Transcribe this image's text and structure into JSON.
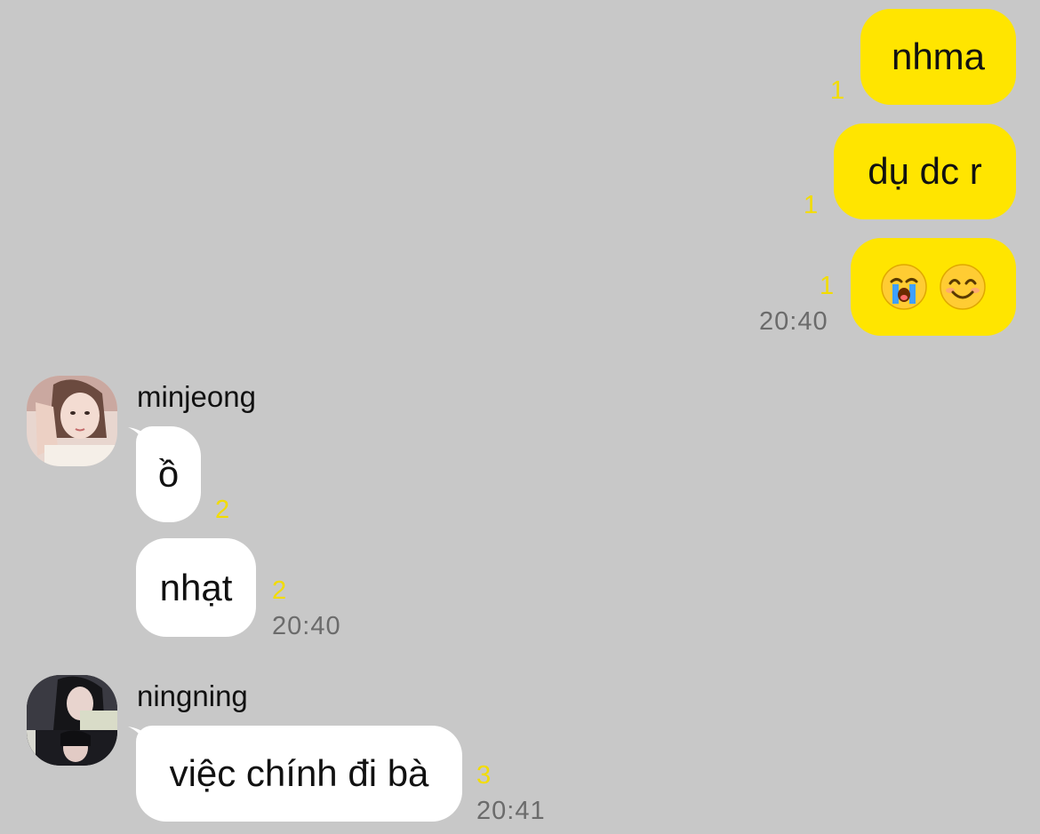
{
  "outgoing": [
    {
      "text": "nhma",
      "unread": "1"
    },
    {
      "text": "dụ dc r",
      "unread": "1"
    },
    {
      "emojis": [
        "loudly-crying-face",
        "smiling-face-with-smiling-eyes"
      ],
      "unread": "1",
      "time": "20:40"
    }
  ],
  "incoming": [
    {
      "sender": "minjeong",
      "avatar": "minjeong-avatar-photo",
      "messages": [
        {
          "text": "ồ",
          "unread": "2"
        },
        {
          "text": "nhạt",
          "unread": "2",
          "time": "20:40"
        }
      ]
    },
    {
      "sender": "ningning",
      "avatar": "ningning-avatar-photo",
      "messages": [
        {
          "text": "việc chính đi bà",
          "unread": "3",
          "time": "20:41"
        }
      ]
    }
  ],
  "colors": {
    "background": "#c8c8c8",
    "outgoing_bubble": "#ffe500",
    "incoming_bubble": "#ffffff",
    "unread_count": "#f2dc00",
    "timestamp": "#6b6b6b"
  }
}
